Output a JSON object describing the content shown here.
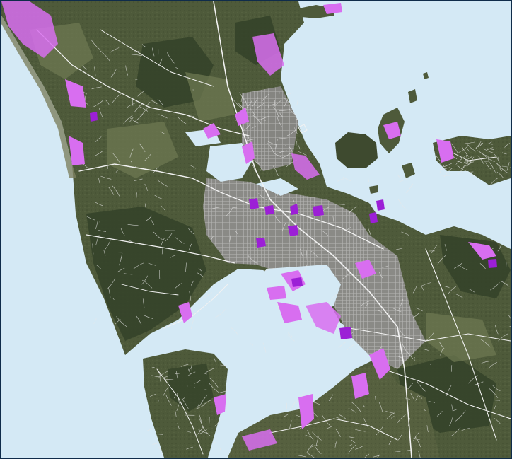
{
  "map": {
    "view": "satellite",
    "features": [
      "land",
      "roads",
      "highlighted-areas"
    ],
    "colors": {
      "water": "#d4e9f5",
      "land": "#4e5a3a",
      "land_dark": "#344229",
      "land_light": "#6e7852",
      "urban": "#8a8a86",
      "roads": "#f2f2f2",
      "highlight": "#d86ef0",
      "highlight_dark": "#9c1fd6",
      "frame": "#0f2c4a"
    }
  }
}
